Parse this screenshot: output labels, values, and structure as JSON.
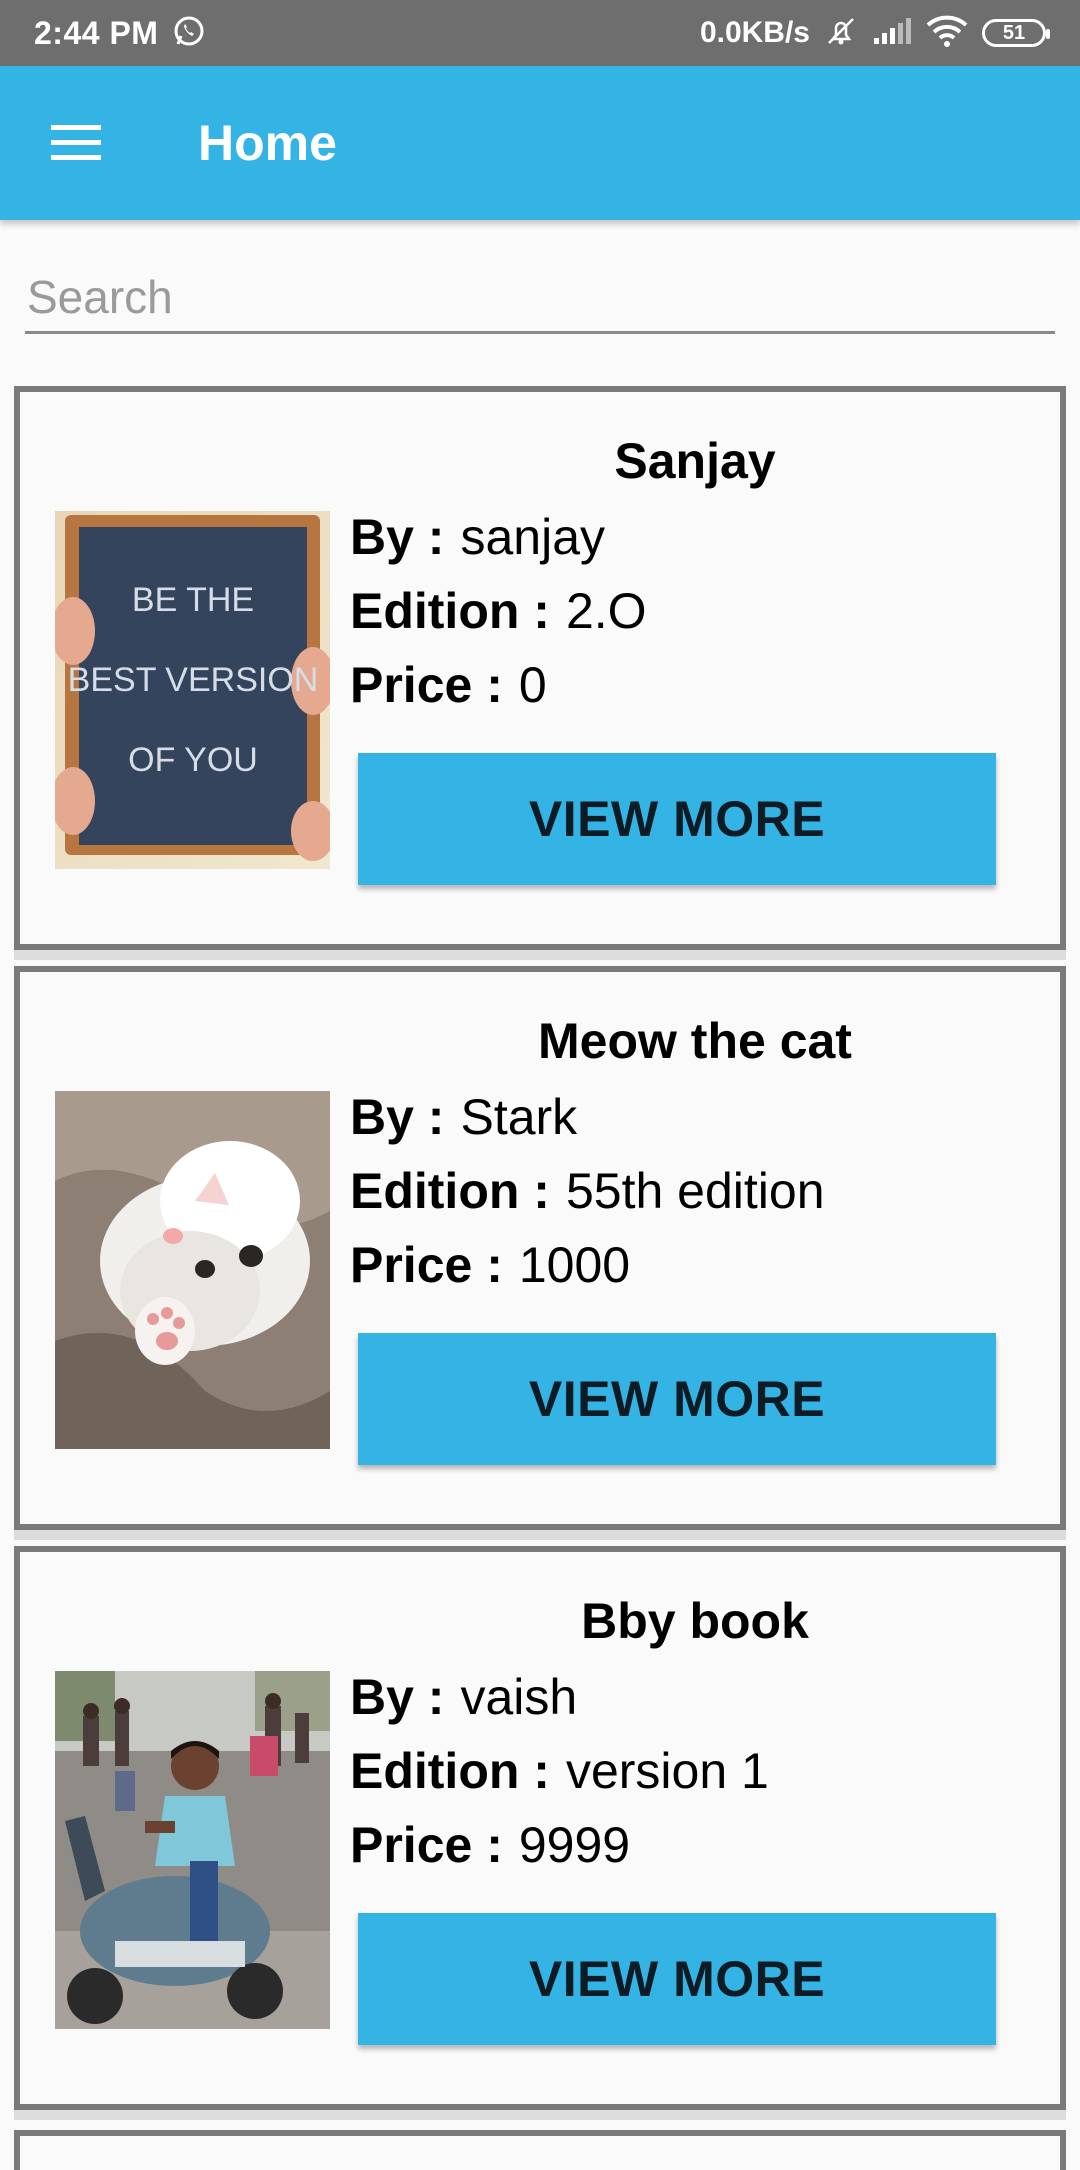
{
  "status_bar": {
    "time": "2:44 PM",
    "speed": "0.0KB/s",
    "battery": "51",
    "icons": [
      "whatsapp-icon",
      "alarm-off-icon",
      "signal-icon",
      "wifi-icon",
      "battery-icon"
    ]
  },
  "app_bar": {
    "title": "Home",
    "menu_icon": "hamburger-menu-icon",
    "color": "#34b4e4"
  },
  "search": {
    "placeholder": "Search",
    "value": ""
  },
  "labels": {
    "by": "By :",
    "edition": "Edition :",
    "price": "Price :",
    "button": "VIEW MORE"
  },
  "books": [
    {
      "title": "Sanjay",
      "by": "sanjay",
      "edition": "2.O",
      "price": "0",
      "cover_text": [
        "BE THE",
        "BEST VERSION",
        "OF YOU"
      ],
      "cover_icon": "chalkboard-quote-image"
    },
    {
      "title": "Meow the cat",
      "by": "Stark",
      "edition": "55th edition",
      "price": "1000",
      "cover_icon": "cat-photo-image"
    },
    {
      "title": "Bby book",
      "by": "vaish",
      "edition": "version 1",
      "price": "9999",
      "cover_icon": "person-on-scooter-photo-image"
    }
  ]
}
